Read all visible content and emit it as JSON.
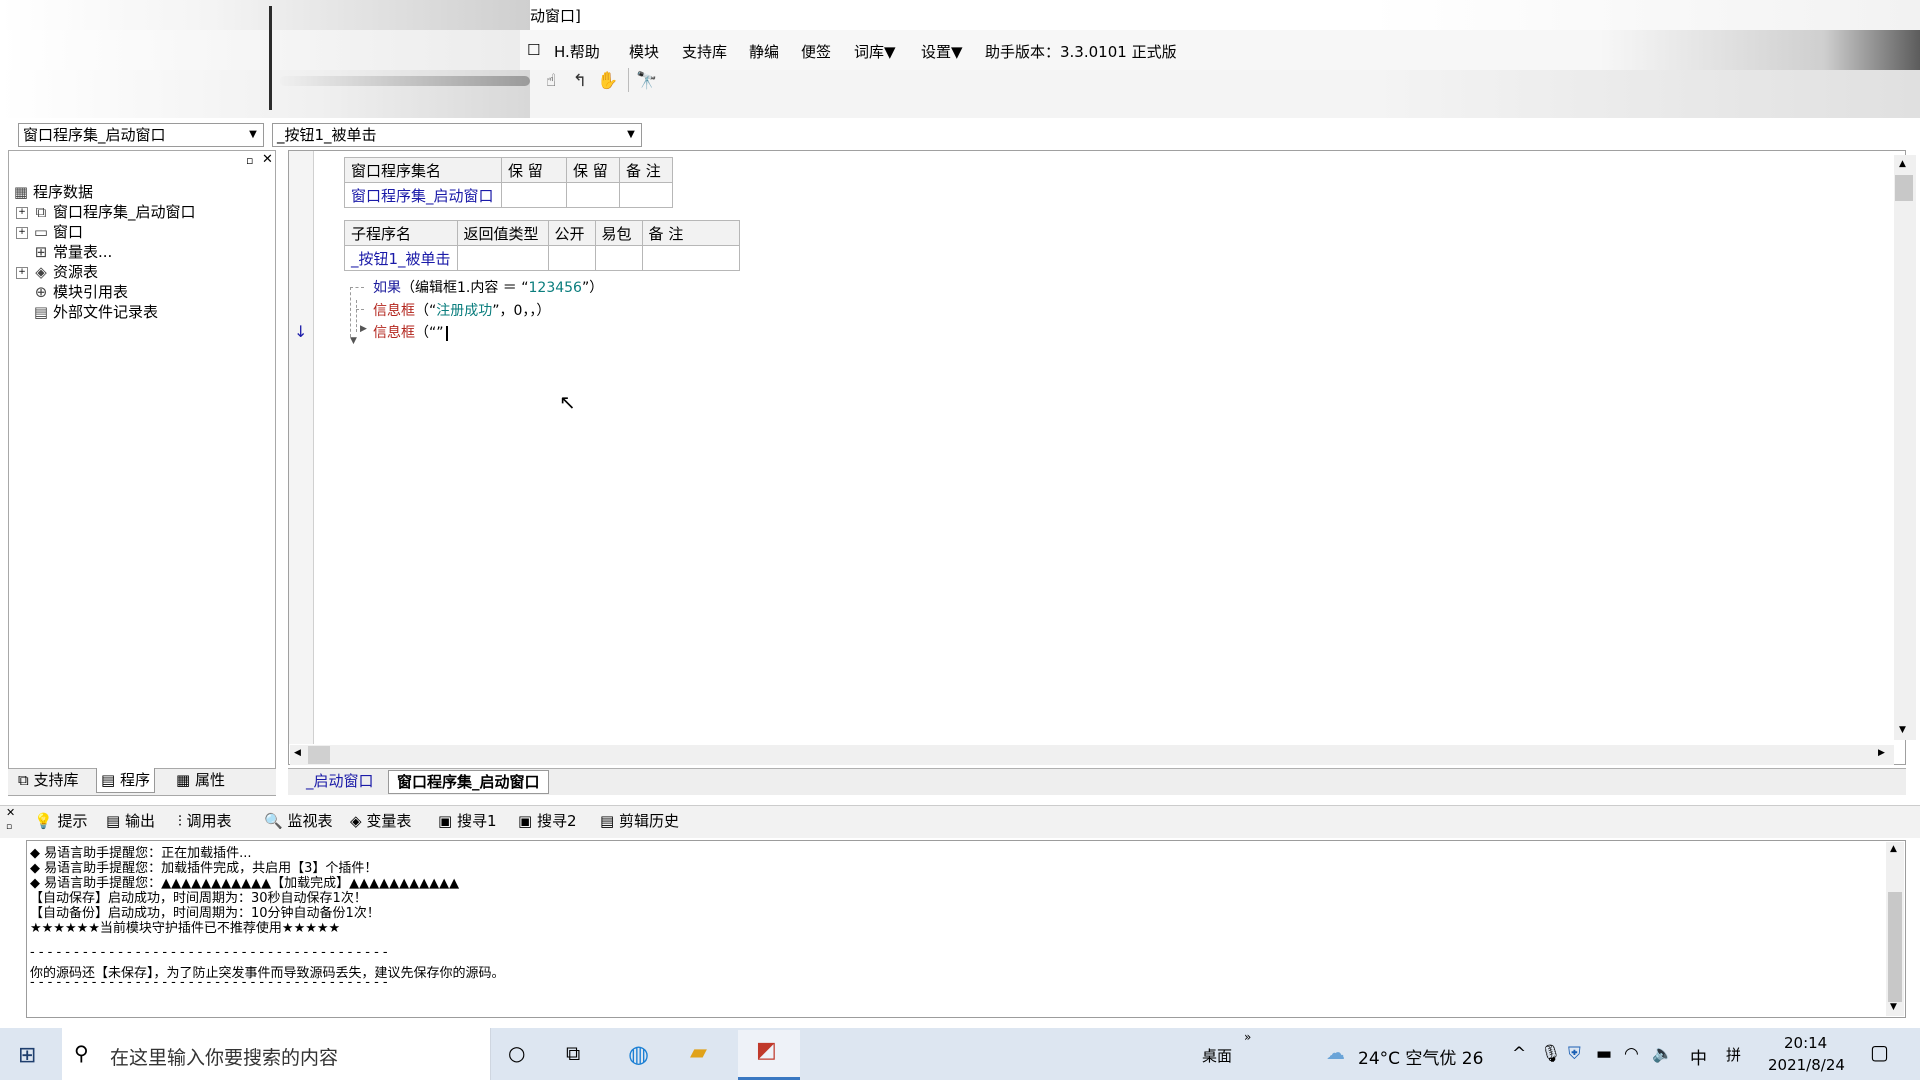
{
  "window": {
    "title": "动窗口]"
  },
  "menu": {
    "checkbox_symbol": "☐",
    "items": [
      "H.帮助",
      "模块",
      "支持库",
      "静编",
      "便签",
      "词库▼",
      "设置▼"
    ],
    "version_label": "助手版本：3.3.0101 正式版"
  },
  "toolbar": {
    "icons": [
      "breakpoint-icon",
      "step-into-icon",
      "hand-icon",
      "find-icon"
    ]
  },
  "combos": {
    "left_value": "窗口程序集_启动窗口",
    "right_value": "_按钮1_被单击"
  },
  "tree": {
    "root": "程序数据",
    "items": [
      {
        "label": "窗口程序集_启动窗口",
        "expander": "+"
      },
      {
        "label": "窗口",
        "expander": "+"
      },
      {
        "label": "常量表...",
        "expander": ""
      },
      {
        "label": "资源表",
        "expander": "+"
      },
      {
        "label": "模块引用表",
        "expander": ""
      },
      {
        "label": "外部文件记录表",
        "expander": ""
      }
    ]
  },
  "left_tabs": [
    "支持库",
    "程序",
    "属性"
  ],
  "assembly_table": {
    "headers": [
      "窗口程序集名",
      "保 留",
      "保 留",
      "备 注"
    ],
    "row": [
      "窗口程序集_启动窗口",
      "",
      "",
      ""
    ]
  },
  "sub_table": {
    "headers": [
      "子程序名",
      "返回值类型",
      "公开",
      "易包",
      "备 注"
    ],
    "row": [
      "_按钮1_被单击",
      "",
      "",
      "",
      ""
    ]
  },
  "code": {
    "line1_kw": "如果",
    "line1_rest": "（编辑框1.内容 ＝ “",
    "line1_str": "123456",
    "line1_end": "”）",
    "line2_kw": "信息框",
    "line2_open": "（“",
    "line2_str": "注册成功",
    "line2_end": "”，0，，）",
    "line3_kw": "信息框",
    "line3_rest": "（“”"
  },
  "file_tabs": [
    "_启动窗口",
    "窗口程序集_启动窗口"
  ],
  "bottom_tabs": [
    "提示",
    "输出",
    "调用表",
    "监视表",
    "变量表",
    "搜寻1",
    "搜寻2",
    "剪辑历史"
  ],
  "output_lines": [
    "◆ 易语言助手提醒您：正在加载插件...",
    "◆ 易语言助手提醒您：加载插件完成，共启用【3】个插件！",
    "◆ 易语言助手提醒您：▲▲▲▲▲▲▲▲▲▲▲【加载完成】▲▲▲▲▲▲▲▲▲▲▲",
    "【自动保存】启动成功，时间周期为：30秒自动保存1次！",
    "【自动备份】启动成功，时间周期为：10分钟自动备份1次！",
    "★★★★★★当前模块守护插件已不推荐使用★★★★★",
    "",
    "- - - - - - - - - - - - - - - - - - - - - - - - - - - - - - - - - - - - - - - - -",
    "你的源码还【未保存】，为了防止突发事件而导致源码丢失，建议先保存你的源码。",
    "- - - - - - - - - - - - - - - - - - - - - - - - - - - - - - - - - - - - - - - - -"
  ],
  "taskbar": {
    "search_placeholder": "在这里输入你要搜索的内容",
    "desktop_label": "桌面",
    "weather": "24°C 空气优 26",
    "ime_lang": "中",
    "ime_mode": "拼",
    "time": "20:14",
    "date": "2021/8/24"
  },
  "colors": {
    "link": "#1a1aa8",
    "keyword_red": "#b3261e",
    "string": "#0a7d7d",
    "taskbar": "#dde6f1"
  }
}
